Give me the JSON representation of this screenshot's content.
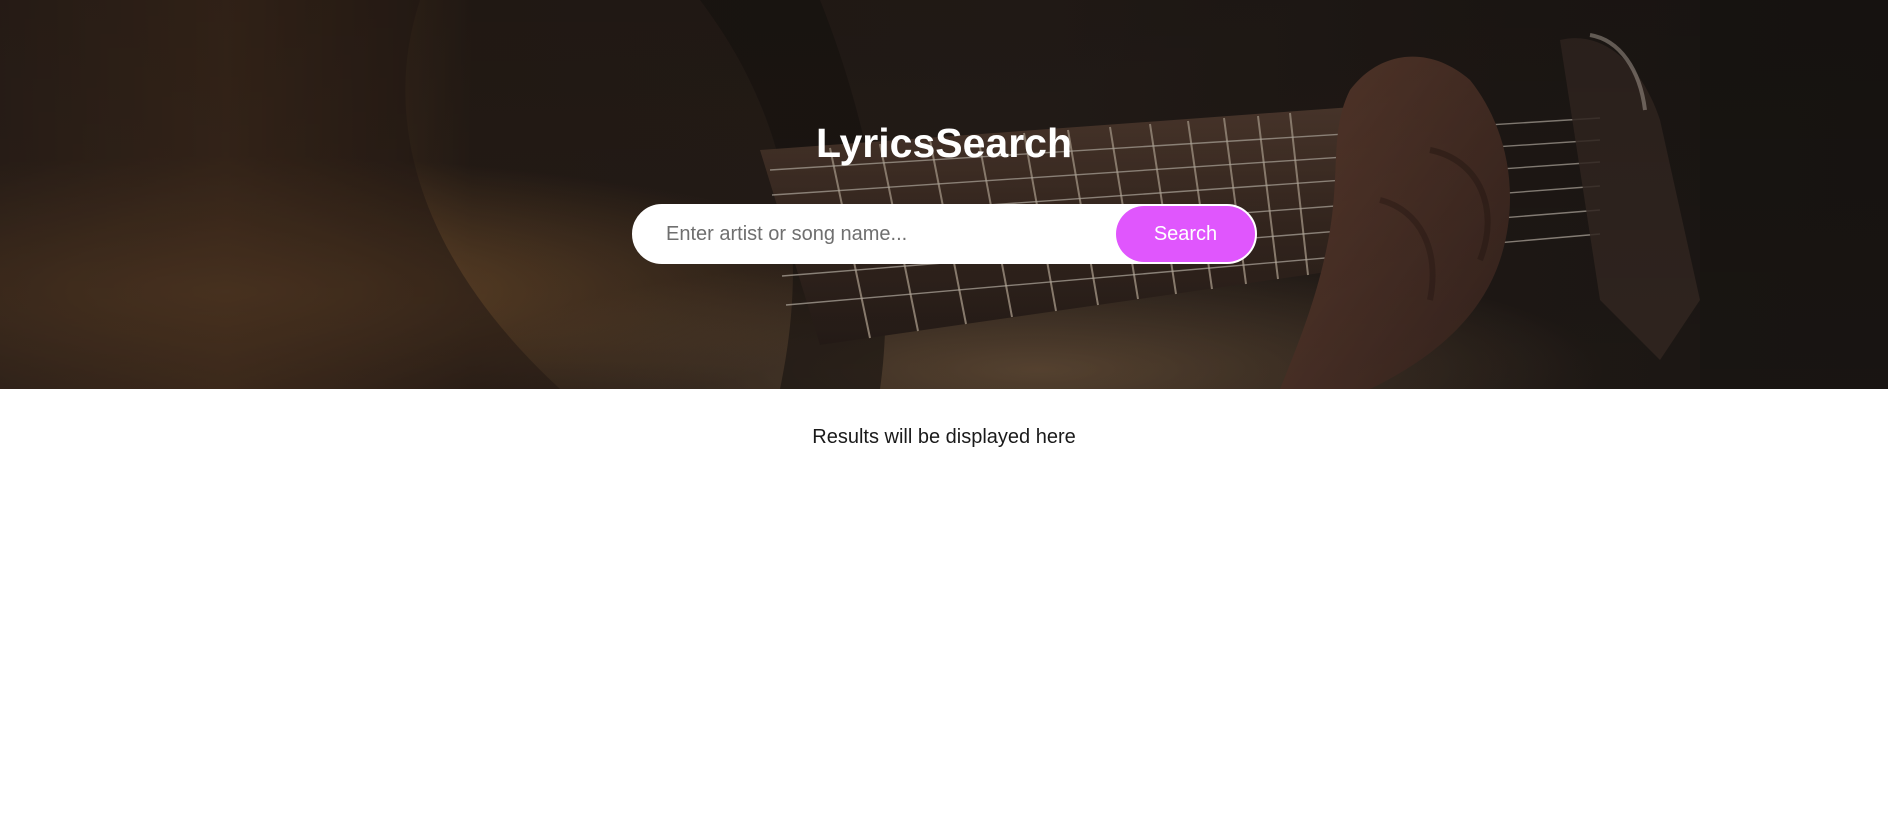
{
  "header": {
    "title": "LyricsSearch",
    "background_image": "acoustic-guitar-fretboard-photo"
  },
  "search": {
    "placeholder": "Enter artist or song name...",
    "value": "",
    "button_label": "Search"
  },
  "results": {
    "placeholder_text": "Results will be displayed here"
  },
  "colors": {
    "accent": "#e056fd",
    "hero_dark": "#2a211c",
    "title_text": "#ffffff"
  }
}
